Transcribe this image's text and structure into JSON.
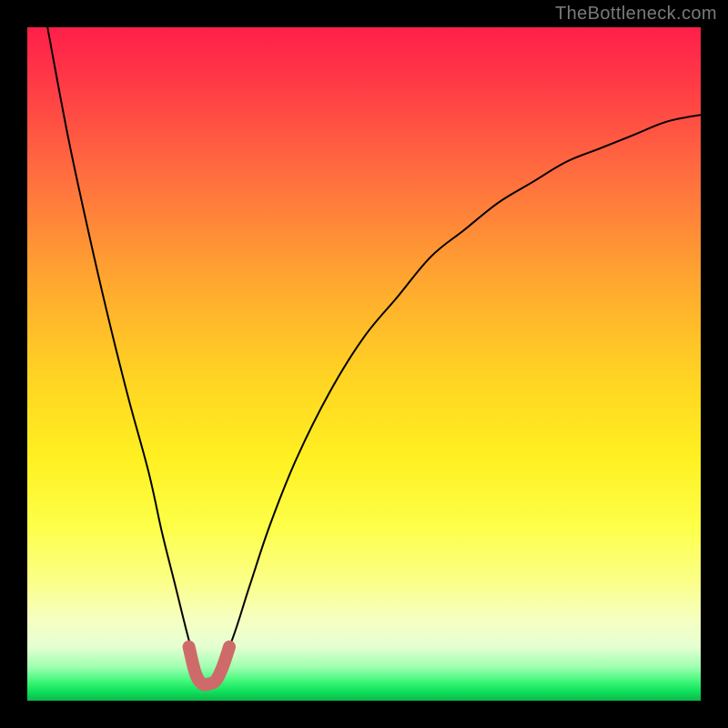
{
  "watermark": "TheBottleneck.com",
  "chart_data": {
    "type": "line",
    "title": "",
    "xlabel": "",
    "ylabel": "",
    "xlim": [
      0,
      100
    ],
    "ylim": [
      0,
      100
    ],
    "grid": false,
    "legend": false,
    "background_gradient": {
      "direction": "bottom",
      "stops": [
        {
          "pos": 0,
          "color": "#ff1f4a"
        },
        {
          "pos": 0.22,
          "color": "#ff6e3f"
        },
        {
          "pos": 0.52,
          "color": "#ffd423"
        },
        {
          "pos": 0.74,
          "color": "#fdff48"
        },
        {
          "pos": 0.92,
          "color": "#e5ffd2"
        },
        {
          "pos": 1.0,
          "color": "#0bb84a"
        }
      ]
    },
    "series": [
      {
        "name": "bottleneck-curve",
        "color": "#000000",
        "width": 2,
        "x": [
          3,
          6,
          9,
          12,
          15,
          18,
          20,
          22,
          24,
          25.5,
          27,
          30,
          33,
          36,
          40,
          45,
          50,
          55,
          60,
          65,
          70,
          75,
          80,
          85,
          90,
          95,
          100
        ],
        "y": [
          100,
          84,
          70,
          57,
          45,
          34,
          25,
          17,
          9,
          4,
          3,
          8,
          17,
          26,
          36,
          46,
          54,
          60,
          66,
          70,
          74,
          77,
          80,
          82,
          84,
          86,
          87
        ]
      },
      {
        "name": "optimal-marker",
        "color": "#cf6a6a",
        "width": 14,
        "linecap": "round",
        "x": [
          24,
          25,
          26,
          27,
          28,
          29,
          30
        ],
        "y": [
          8,
          4,
          2.5,
          2.5,
          3,
          5,
          8
        ]
      }
    ],
    "annotations": []
  }
}
